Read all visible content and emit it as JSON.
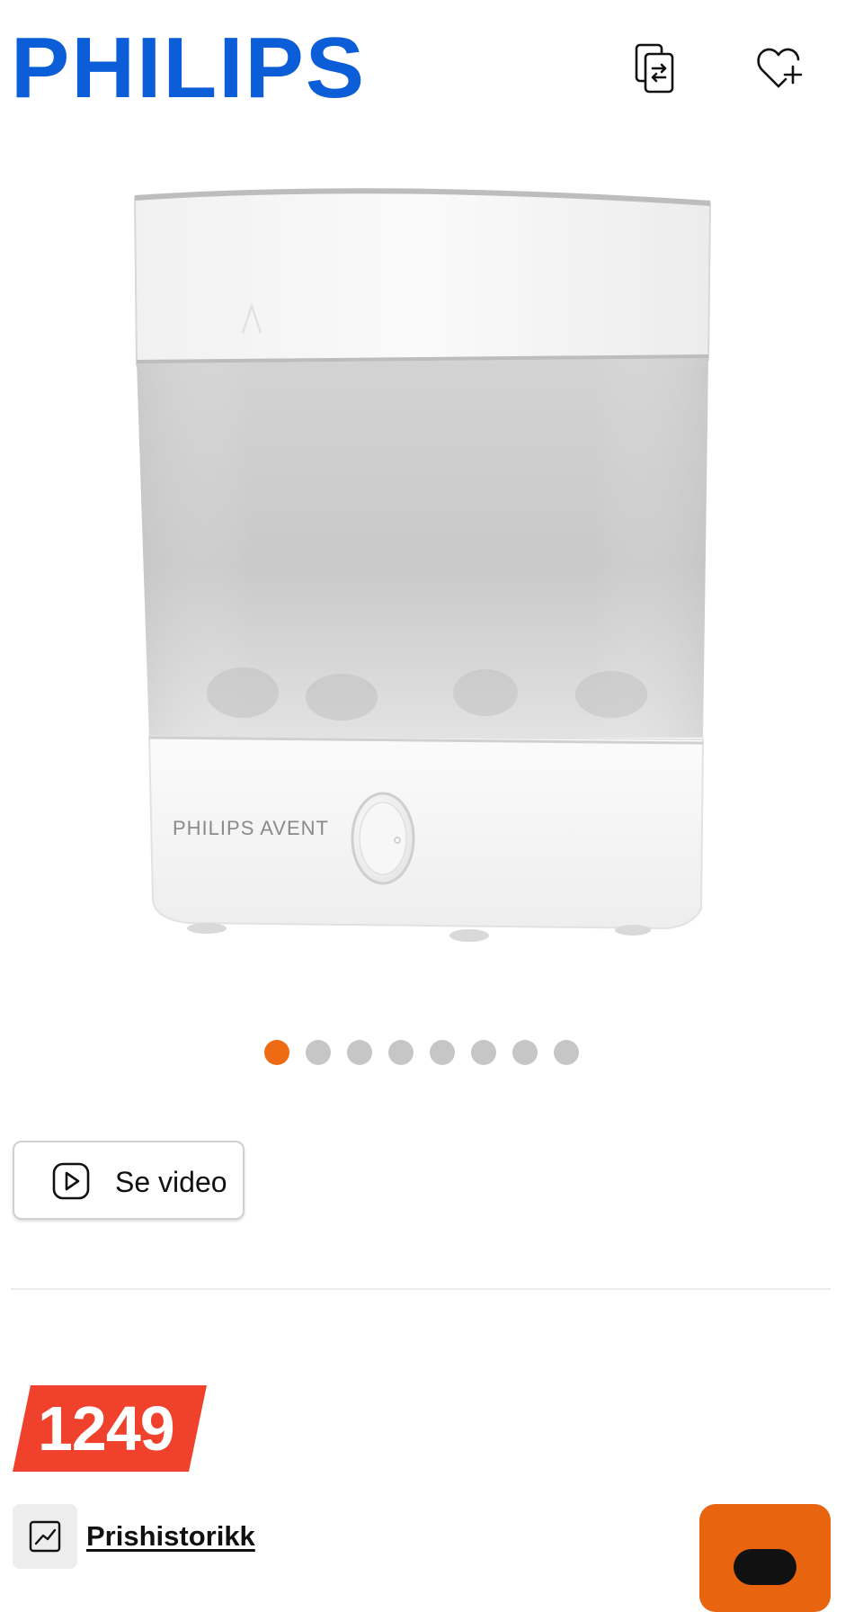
{
  "header": {
    "brand": "PHILIPS",
    "compare_icon": "compare-icon",
    "wishlist_icon": "heart-plus-icon",
    "brand_color": "#0b5ed7"
  },
  "product": {
    "image_label": "PHILIPS AVENT",
    "image_count": 8,
    "active_image": 1
  },
  "video_button": {
    "label": "Se video",
    "icon": "play-icon"
  },
  "price": {
    "value": "1249",
    "tag_color": "#f0412d"
  },
  "price_history": {
    "label": "Prishistorikk",
    "icon": "chart-line-icon"
  },
  "cart_button": {
    "color": "#e8640f"
  },
  "colors": {
    "accent": "#ee6a13",
    "dot_inactive": "#c6c6c6"
  }
}
